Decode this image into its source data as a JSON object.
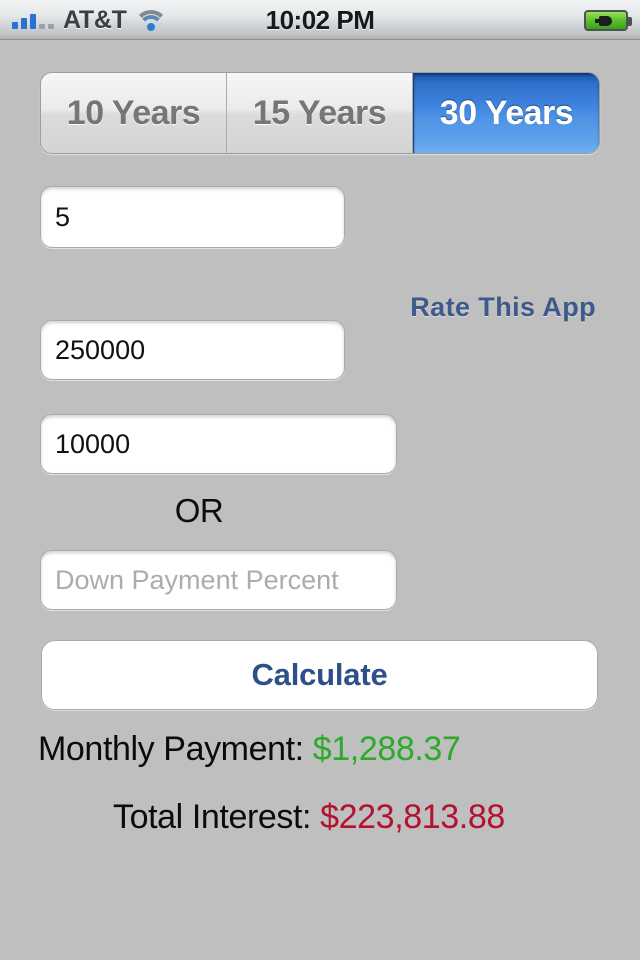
{
  "status_bar": {
    "carrier": "AT&T",
    "time": "10:02 PM",
    "signal_icon": "signal-bars-icon",
    "wifi_icon": "wifi-icon",
    "battery_icon": "battery-charging-icon",
    "signal_bars_filled": 3,
    "signal_bars_total": 5
  },
  "term_selector": {
    "options": [
      {
        "label": "10 Years",
        "selected": false
      },
      {
        "label": "15 Years",
        "selected": false
      },
      {
        "label": "30 Years",
        "selected": true
      }
    ],
    "selected_value": "30 Years",
    "selected_color": "#3d82dd"
  },
  "fields": {
    "interest_rate": {
      "value": "5",
      "placeholder": ""
    },
    "loan_amount": {
      "value": "250000",
      "placeholder": ""
    },
    "down_payment_amount": {
      "value": "10000",
      "placeholder": ""
    },
    "down_payment_percent": {
      "value": "",
      "placeholder": "Down Payment Percent"
    }
  },
  "divider": {
    "text": "________________________________________"
  },
  "links": {
    "rate_this_app": "Rate This App",
    "rate_this_app_color": "#3d5a8a"
  },
  "labels": {
    "or": "OR"
  },
  "actions": {
    "calculate": "Calculate",
    "calculate_color": "#2d5089"
  },
  "results": {
    "monthly_payment_label": "Monthly Payment:",
    "monthly_payment_value": "$1,288.37",
    "monthly_payment_color": "#2caa2a",
    "total_interest_label": "Total Interest:",
    "total_interest_value": "$223,813.88",
    "total_interest_color": "#b3122f"
  },
  "theme": {
    "background": "#bfbfbf"
  }
}
